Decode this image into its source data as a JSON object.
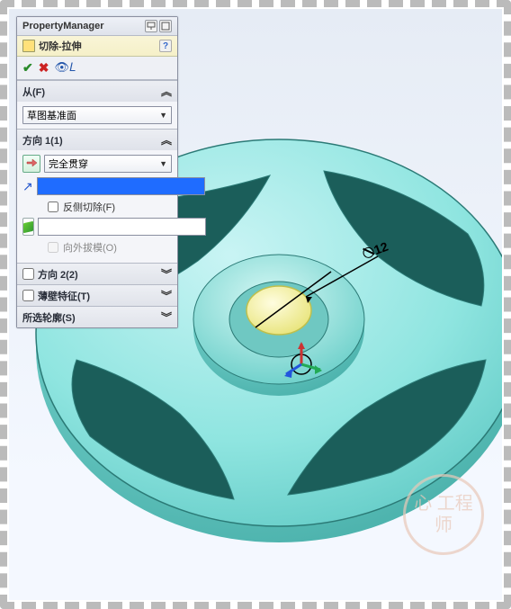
{
  "pm": {
    "title": "PropertyManager",
    "feature_name": "切除-拉伸",
    "help": "?"
  },
  "from": {
    "label": "从(F)",
    "option": "草图基准面"
  },
  "dir1": {
    "label": "方向 1(1)",
    "end_condition": "完全贯穿",
    "depth_value": "",
    "reverse_label": "反侧切除(F)",
    "draft_value": "",
    "outward_label": "向外拔模(O)"
  },
  "dir2": {
    "label": "方向 2(2)"
  },
  "thin": {
    "label": "薄壁特征(T)"
  },
  "contours": {
    "label": "所选轮廓(S)"
  },
  "dimension": "12",
  "watermark": "心\n工程师"
}
